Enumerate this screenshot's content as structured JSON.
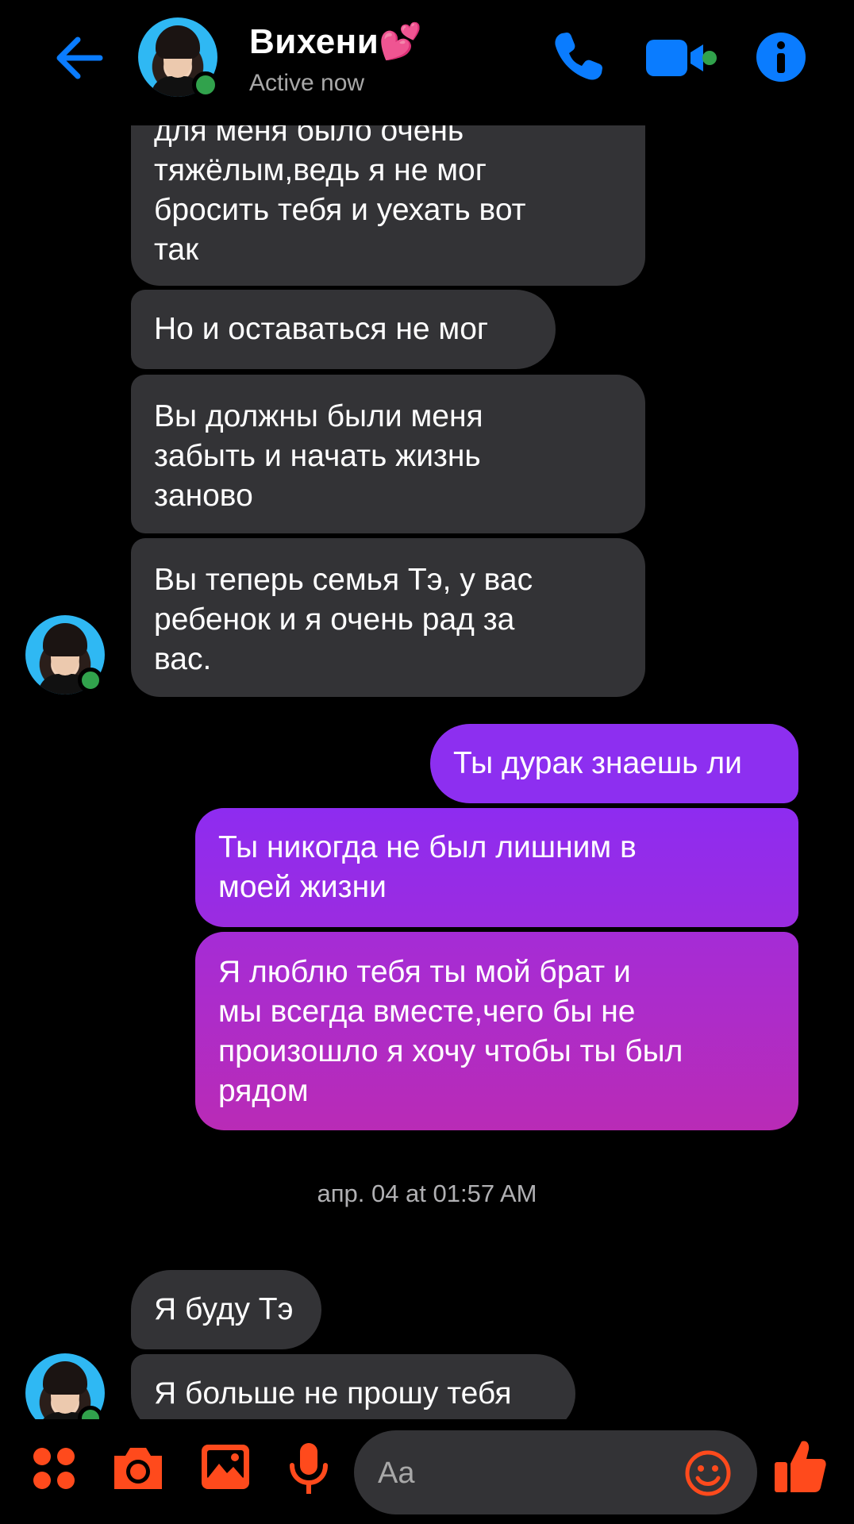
{
  "header": {
    "name": "Вихени💕",
    "status": "Active now"
  },
  "messages": [
    {
      "side": "in",
      "text": "для меня было очень\nтяжёлым,ведь я не мог\nбросить тебя и уехать вот\nтак"
    },
    {
      "side": "in",
      "text": "Но и оставаться не мог"
    },
    {
      "side": "in",
      "text": "Вы должны были меня\nзабыть и начать жизнь\nзаново"
    },
    {
      "side": "in",
      "text": "Вы теперь семья Тэ, у вас\nребенок и я очень рад за\nвас."
    },
    {
      "side": "out",
      "text": "Ты дурак знаешь ли"
    },
    {
      "side": "out",
      "text": "Ты никогда не был лишним в\nмоей жизни"
    },
    {
      "side": "out",
      "text": "Я люблю тебя ты мой брат и\nмы всегда вместе,чего бы не\nпроизошло я хочу чтобы ты был\nрядом"
    },
    {
      "side": "in",
      "text": "Я буду Тэ"
    },
    {
      "side": "in",
      "text": "Я больше не прошу тебя"
    }
  ],
  "timestamp": "апр. 04 at 01:57 AM",
  "composer": {
    "placeholder": "Aa"
  },
  "icons": {
    "back": "back-arrow-icon",
    "call": "phone-icon",
    "video": "video-camera-icon",
    "info": "info-icon",
    "menu": "four-dots-icon",
    "camera": "camera-icon",
    "gallery": "image-icon",
    "mic": "microphone-icon",
    "emoji": "smiley-icon",
    "like": "thumbs-up-icon"
  },
  "colors": {
    "accent_header": "#0a7cff",
    "accent_composer": "#ff4a1c",
    "incoming_bubble": "#333336",
    "outgoing_top": "#8a2be2",
    "outgoing_bottom": "#b92bb6",
    "online": "#31a24c"
  }
}
